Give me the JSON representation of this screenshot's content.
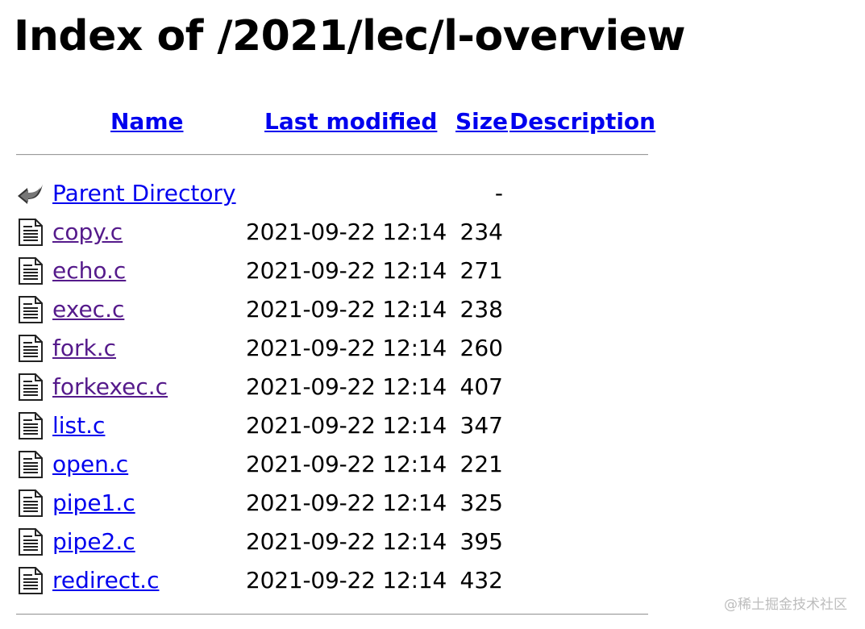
{
  "page": {
    "title": "Index of /2021/lec/l-overview"
  },
  "columns": {
    "name": "Name",
    "last_modified": "Last modified",
    "size": "Size",
    "description": "Description"
  },
  "parent": {
    "label": "Parent Directory",
    "size": "-",
    "icon": "back-arrow-icon"
  },
  "files": [
    {
      "name": "copy.c",
      "modified": "2021-09-22 12:14",
      "size": "234",
      "visited": true,
      "icon": "text-file-icon"
    },
    {
      "name": "echo.c",
      "modified": "2021-09-22 12:14",
      "size": "271",
      "visited": true,
      "icon": "text-file-icon"
    },
    {
      "name": "exec.c",
      "modified": "2021-09-22 12:14",
      "size": "238",
      "visited": true,
      "icon": "text-file-icon"
    },
    {
      "name": "fork.c",
      "modified": "2021-09-22 12:14",
      "size": "260",
      "visited": true,
      "icon": "text-file-icon"
    },
    {
      "name": "forkexec.c",
      "modified": "2021-09-22 12:14",
      "size": "407",
      "visited": true,
      "icon": "text-file-icon"
    },
    {
      "name": "list.c",
      "modified": "2021-09-22 12:14",
      "size": "347",
      "visited": false,
      "icon": "text-file-icon"
    },
    {
      "name": "open.c",
      "modified": "2021-09-22 12:14",
      "size": "221",
      "visited": false,
      "icon": "text-file-icon"
    },
    {
      "name": "pipe1.c",
      "modified": "2021-09-22 12:14",
      "size": "325",
      "visited": false,
      "icon": "text-file-icon"
    },
    {
      "name": "pipe2.c",
      "modified": "2021-09-22 12:14",
      "size": "395",
      "visited": false,
      "icon": "text-file-icon"
    },
    {
      "name": "redirect.c",
      "modified": "2021-09-22 12:14",
      "size": "432",
      "visited": false,
      "icon": "text-file-icon"
    }
  ],
  "watermark": "@稀土掘金技术社区",
  "colors": {
    "link": "#0000ee",
    "visited_link": "#551a8b",
    "rule": "#9a9a9a"
  }
}
